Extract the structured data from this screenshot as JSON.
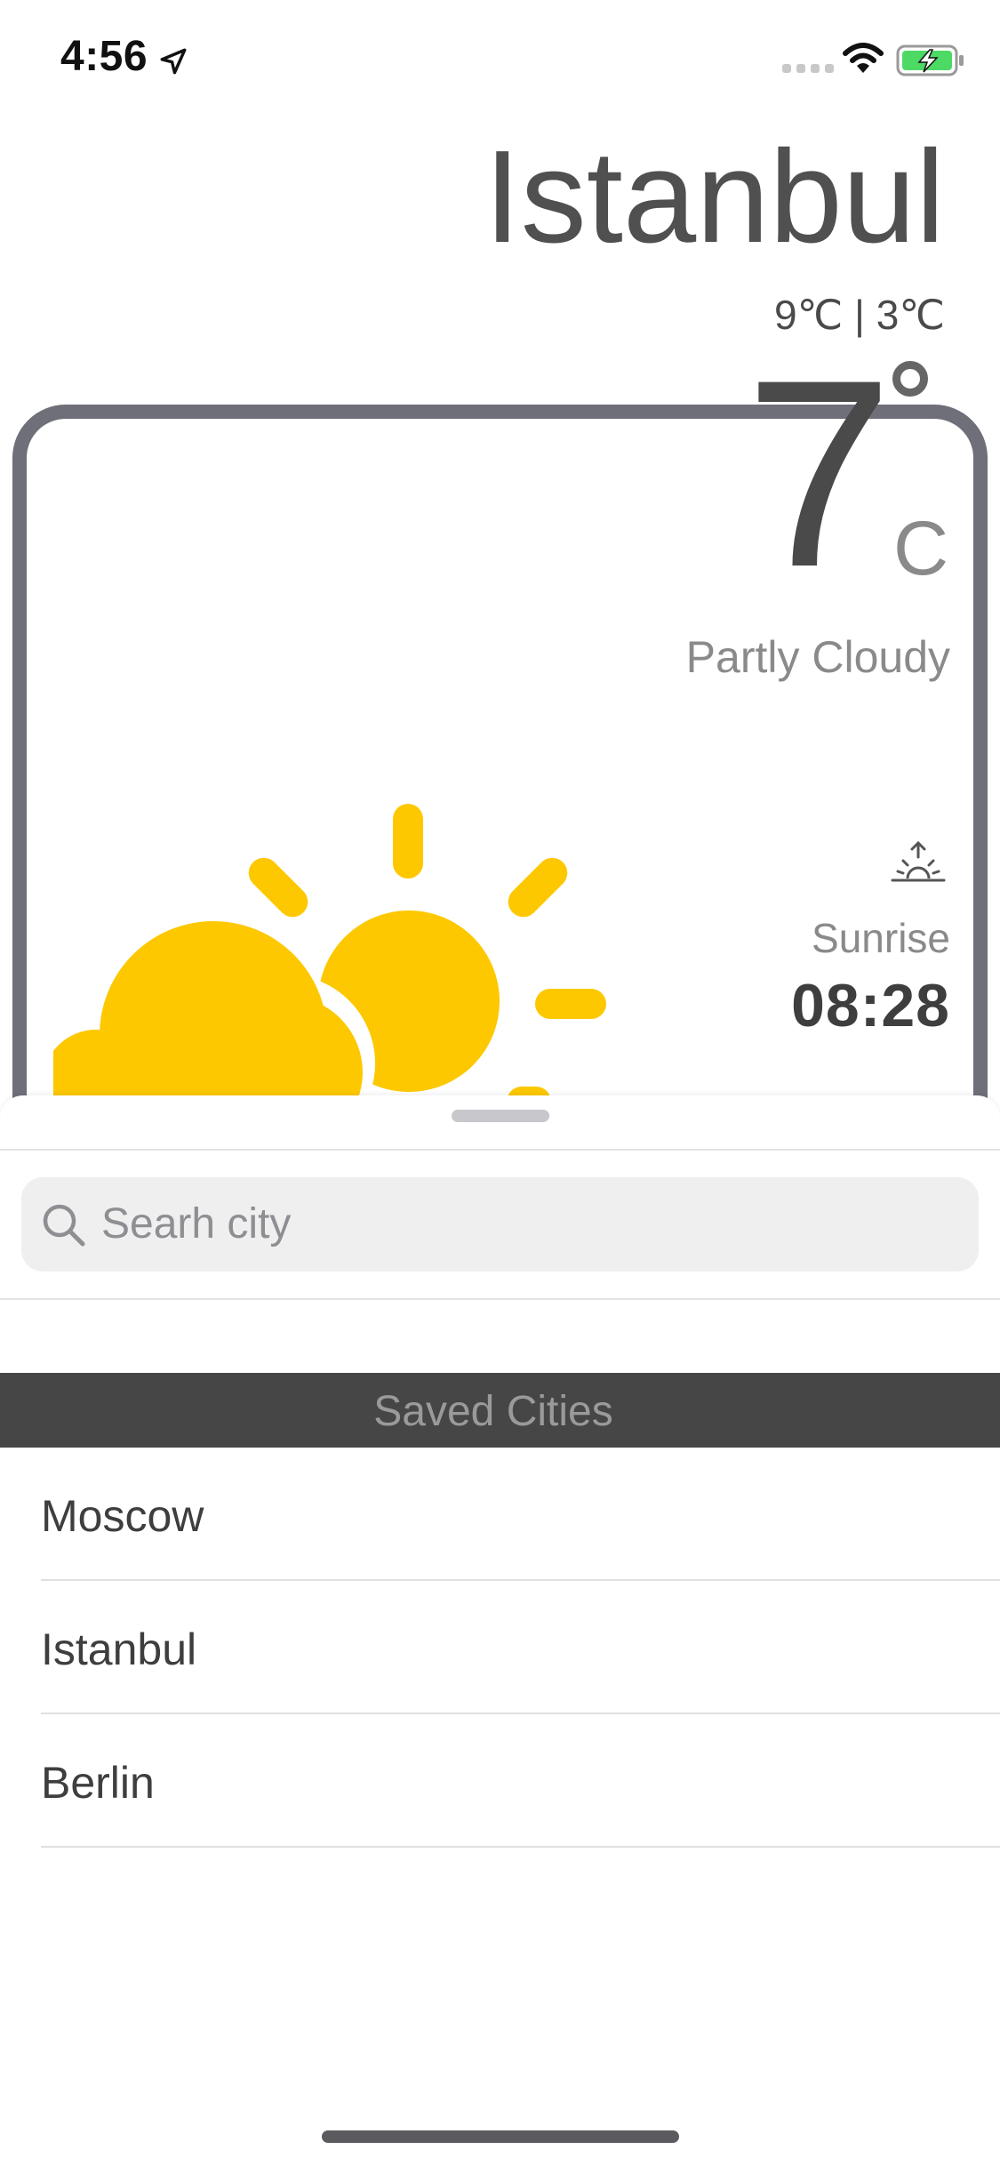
{
  "status_bar": {
    "time": "4:56",
    "battery_color": "#4cd964"
  },
  "weather": {
    "city": "Istanbul",
    "high_low": "9℃ | 3℃",
    "temperature": "7",
    "unit": "C",
    "condition": "Partly Cloudy",
    "sunrise_label": "Sunrise",
    "sunrise_time": "08:28",
    "sun_color": "#fdc800"
  },
  "sheet": {
    "search_placeholder": "Searh city",
    "saved_header": "Saved Cities",
    "cities": [
      {
        "name": "Moscow"
      },
      {
        "name": "Istanbul"
      },
      {
        "name": "Berlin"
      }
    ]
  }
}
